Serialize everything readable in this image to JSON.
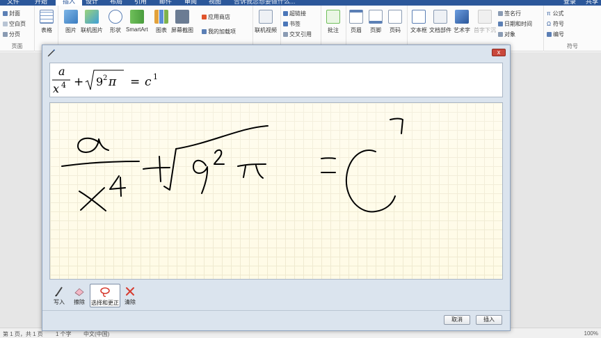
{
  "tabs": {
    "file": "文件",
    "home": "开始",
    "insert": "插入",
    "design": "设计",
    "layout": "布局",
    "references": "引用",
    "mailings": "邮件",
    "review": "审阅",
    "view": "视图",
    "tell_me": "告诉我您想要做什么...",
    "login": "登录",
    "share": "共享"
  },
  "ribbon": {
    "pages": {
      "cover": "封面",
      "blank": "空白页",
      "break": "分页",
      "label": "页面"
    },
    "table": "表格",
    "picture": "图片",
    "online_picture": "联机图片",
    "shapes": "形状",
    "smartart": "SmartArt",
    "chart": "图表",
    "screenshot": "屏幕截图",
    "store": "应用商店",
    "my_addins": "我的加载项",
    "online_video": "联机视频",
    "hyperlink": "超链接",
    "bookmark": "书签",
    "cross_ref": "交叉引用",
    "comment": "批注",
    "header": "页眉",
    "footer": "页脚",
    "page_number": "页码",
    "text_box": "文本框",
    "doc_parts": "文档部件",
    "wordart": "艺术字",
    "drop_cap": "首字下沉",
    "signature": "签名行",
    "datetime": "日期和时间",
    "object": "对象",
    "equation": "公式",
    "symbol": "符号",
    "number": "编号",
    "symbols_label": "符号"
  },
  "status": {
    "page": "第 1 页，共 1 页",
    "words": "1 个字",
    "lang": "中文(中国)",
    "zoom": "100%"
  },
  "dialog": {
    "close": "x",
    "preview": {
      "numerator": "a",
      "denominator_base": "x",
      "denominator_exp": "4",
      "plus": "+",
      "radicand_base": "9",
      "radicand_exp": "2",
      "pi": "π",
      "equals": "=",
      "rhs_base": "c",
      "rhs_exp": "1"
    },
    "tools": {
      "write": "写入",
      "erase": "擦除",
      "select_correct": "选择和更正",
      "clear": "清除"
    },
    "buttons": {
      "cancel": "取消",
      "insert": "插入"
    }
  },
  "colors": {
    "ribbon_blue": "#2b579a",
    "canvas_bg": "#fffbe6",
    "ink": "#000000"
  }
}
